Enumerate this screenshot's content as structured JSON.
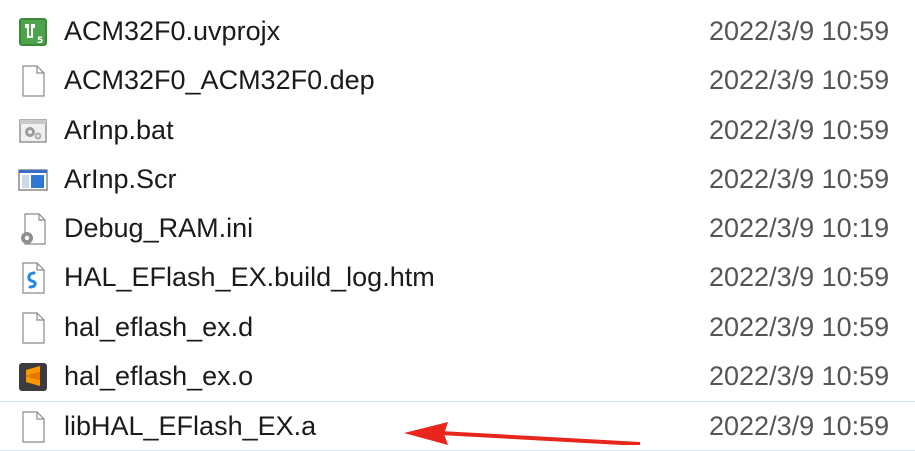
{
  "files": [
    {
      "name": "ACM32F0.uvprojx",
      "modified": "2022/3/9 10:59",
      "icon": "keil-project-icon"
    },
    {
      "name": "ACM32F0_ACM32F0.dep",
      "modified": "2022/3/9 10:59",
      "icon": "blank-file-icon"
    },
    {
      "name": "ArInp.bat",
      "modified": "2022/3/9 10:59",
      "icon": "batch-file-icon"
    },
    {
      "name": "ArInp.Scr",
      "modified": "2022/3/9 10:59",
      "icon": "screensaver-file-icon"
    },
    {
      "name": "Debug_RAM.ini",
      "modified": "2022/3/9 10:19",
      "icon": "config-file-icon"
    },
    {
      "name": "HAL_EFlash_EX.build_log.htm",
      "modified": "2022/3/9 10:59",
      "icon": "html-file-icon"
    },
    {
      "name": "hal_eflash_ex.d",
      "modified": "2022/3/9 10:59",
      "icon": "blank-file-icon"
    },
    {
      "name": "hal_eflash_ex.o",
      "modified": "2022/3/9 10:59",
      "icon": "sublime-file-icon"
    },
    {
      "name": "libHAL_EFlash_EX.a",
      "modified": "2022/3/9 10:59",
      "icon": "blank-file-icon"
    }
  ],
  "annotation": {
    "type": "red-arrow",
    "points_to": "libHAL_EFlash_EX.a",
    "color": "#e8261c"
  }
}
